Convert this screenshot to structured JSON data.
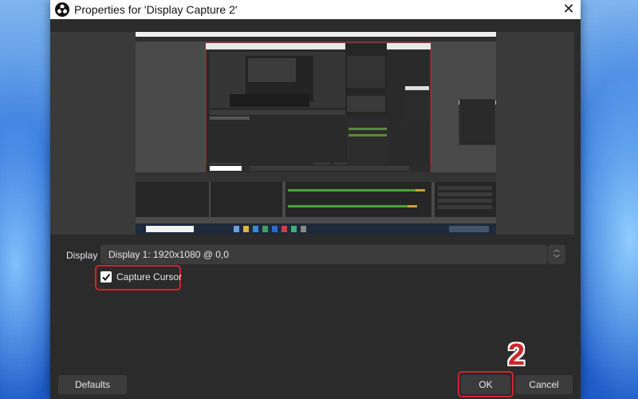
{
  "window": {
    "title": "Properties for 'Display Capture 2'",
    "close_glyph": "✕",
    "app_icon": "obs-icon"
  },
  "form": {
    "display_label": "Display",
    "display_value": "Display 1: 1920x1080 @ 0,0",
    "capture_cursor_label": "Capture Cursor",
    "capture_cursor_checked": true
  },
  "buttons": {
    "defaults": "Defaults",
    "ok": "OK",
    "cancel": "Cancel"
  },
  "annotation": {
    "step_number": "2",
    "highlight_color": "#d0242c"
  }
}
